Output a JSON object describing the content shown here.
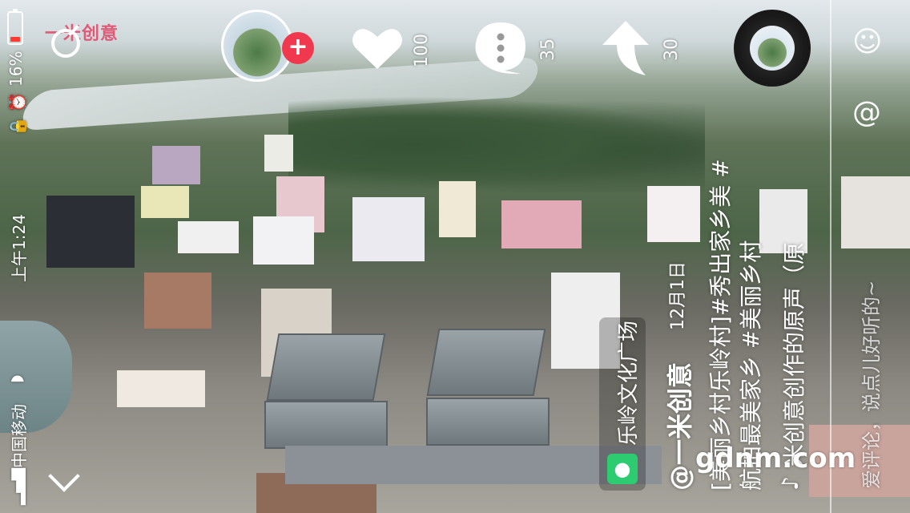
{
  "status_bar": {
    "battery_percent": "16%",
    "time": "上午1:24",
    "carrier": "中国移动"
  },
  "header": {
    "logo_text": "一米创意"
  },
  "actions": {
    "like_count": "100",
    "comment_count": "35",
    "share_count": "30"
  },
  "caption": {
    "author": "@一米创意",
    "date": "12月1日",
    "location": "乐岭文化广场",
    "text_line1": "[美丽乡村乐岭村]#秀出家乡美 #",
    "text_line2": "航拍最美家乡 #美丽乡村",
    "music": "米创意创作的原声（原",
    "comment_hint": "爱评论，说点儿好听的~"
  },
  "watermark": "gdnm.com",
  "icons": [
    "battery-icon",
    "alarm-icon",
    "lock-icon",
    "wifi-icon",
    "signal-icon",
    "search-icon",
    "plus-icon",
    "heart-icon",
    "comment-icon",
    "share-icon",
    "music-disc-icon",
    "emoji-icon",
    "at-icon",
    "location-pin-icon",
    "chevron-down-icon",
    "music-note-icon"
  ],
  "colors": {
    "accent_red": "#f0394f",
    "location_green": "#2ecc71",
    "logo_pink": "#e05a78"
  }
}
